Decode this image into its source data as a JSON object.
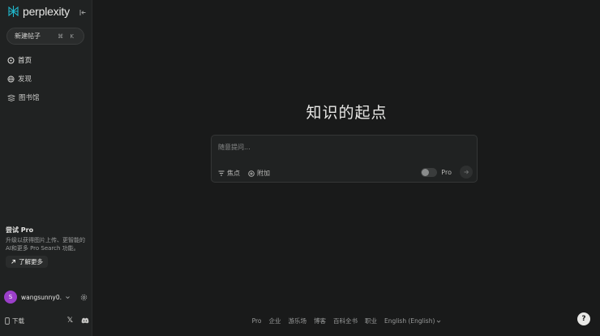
{
  "app": {
    "logo_text": "perplexity"
  },
  "sidebar": {
    "new_thread_label": "新建帖子",
    "new_thread_shortcut": "⌘ K",
    "items": [
      {
        "label": "首页",
        "icon": "home-search-icon",
        "active": true
      },
      {
        "label": "发现",
        "icon": "globe-icon",
        "active": false
      },
      {
        "label": "图书馆",
        "icon": "library-icon",
        "active": false
      }
    ],
    "pro": {
      "title": "尝试 Pro",
      "desc": "升级以获得图片上传、更智能的AI和更多 Pro Search 功能。",
      "learn_more": "了解更多"
    },
    "user": {
      "avatar_letter": "S",
      "name": "wangsunny0...",
      "avatar_color": "#9b3fc9"
    },
    "download_label": "下载"
  },
  "main": {
    "hero": "知识的起点",
    "ask": {
      "placeholder": "随意提问...",
      "focus_label": "焦点",
      "attach_label": "附加",
      "pro_label": "Pro"
    },
    "footer": [
      "Pro",
      "企业",
      "游乐场",
      "博客",
      "百科全书",
      "职业",
      "English (English)"
    ],
    "help_label": "?"
  }
}
